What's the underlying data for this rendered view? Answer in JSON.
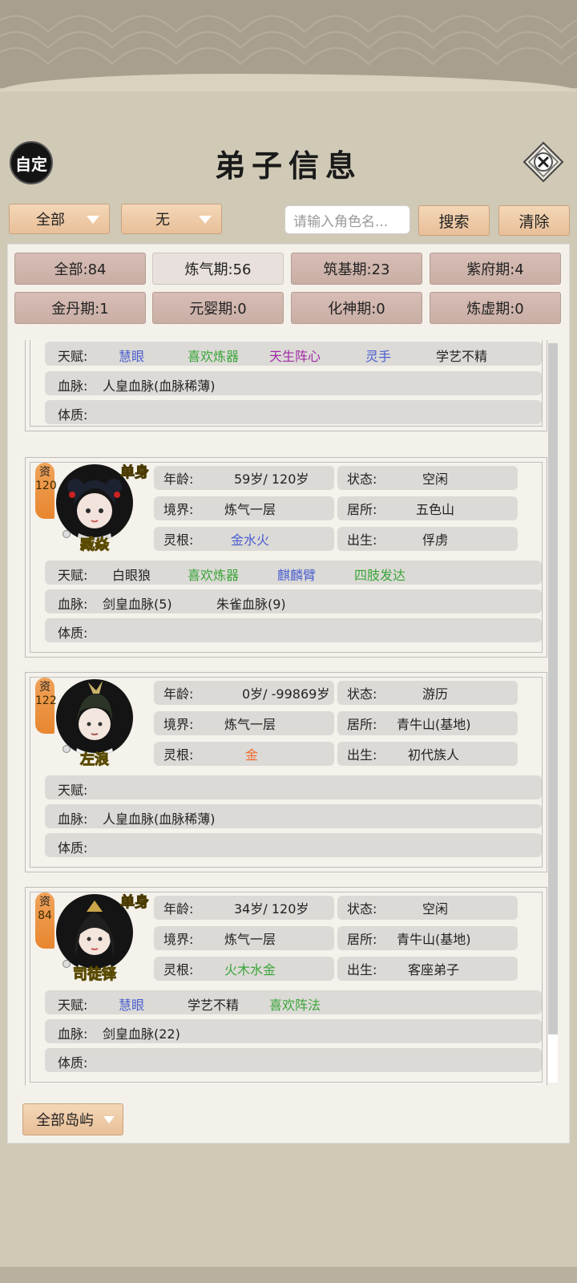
{
  "header": {
    "title": "弟子信息",
    "custom_label": "自定"
  },
  "filters_top": {
    "category": "全部",
    "secondary": "无",
    "search_placeholder": "请输入角色名...",
    "search_label": "搜索",
    "clear_label": "清除"
  },
  "realm_filters": [
    {
      "label": "全部:84",
      "active": false
    },
    {
      "label": "炼气期:56",
      "active": true
    },
    {
      "label": "筑基期:23",
      "active": false
    },
    {
      "label": "紫府期:4",
      "active": false
    },
    {
      "label": "金丹期:1",
      "active": false
    },
    {
      "label": "元婴期:0",
      "active": false
    },
    {
      "label": "化神期:0",
      "active": false
    },
    {
      "label": "炼虚期:0",
      "active": false
    }
  ],
  "labels": {
    "age": "年龄:",
    "status": "状态:",
    "realm": "境界:",
    "residence": "居所:",
    "root": "灵根:",
    "birth": "出生:",
    "talent": "天赋:",
    "bloodline": "血脉:",
    "constitution": "体质:",
    "aptitude": "资",
    "single": "单身"
  },
  "partial_card": {
    "talents": [
      {
        "text": "慧眼",
        "color": "#4a5fd0"
      },
      {
        "text": "喜欢炼器",
        "color": "#3aa53a"
      },
      {
        "text": "天生阵心",
        "color": "#a02aa8"
      },
      {
        "text": "灵手",
        "color": "#4a5fd0"
      },
      {
        "text": "学艺不精",
        "color": "#222222"
      }
    ],
    "bloodlines": [
      "人皇血脉(血脉稀薄)"
    ],
    "constitution": ""
  },
  "disciples": [
    {
      "name": "臧焱",
      "aptitude": "120",
      "single": true,
      "age": "59岁/ 120岁",
      "status": "空闲",
      "realm": "炼气一层",
      "residence": "五色山",
      "root": "金水火",
      "root_color": "#4a5fd0",
      "birth": "俘虏",
      "talents": [
        {
          "text": "白眼狼",
          "color": "#222222"
        },
        {
          "text": "喜欢炼器",
          "color": "#3aa53a"
        },
        {
          "text": "麒麟臂",
          "color": "#4a5fd0"
        },
        {
          "text": "四肢发达",
          "color": "#3aa53a"
        }
      ],
      "bloodlines": [
        "剑皇血脉(5)",
        "朱雀血脉(9)"
      ],
      "constitution": ""
    },
    {
      "name": "左浪",
      "aptitude": "122",
      "single": false,
      "age": "0岁/ -99869岁",
      "status": "游历",
      "realm": "炼气一层",
      "residence": "青牛山(基地)",
      "root": "金",
      "root_color": "#ee6a2e",
      "birth": "初代族人",
      "talents": [],
      "bloodlines": [
        "人皇血脉(血脉稀薄)"
      ],
      "constitution": ""
    },
    {
      "name": "司徒铎",
      "aptitude": "84",
      "single": true,
      "age": "34岁/ 120岁",
      "status": "空闲",
      "realm": "炼气一层",
      "residence": "青牛山(基地)",
      "root": "火木水金",
      "root_color": "#3aa53a",
      "birth": "客座弟子",
      "talents": [
        {
          "text": "慧眼",
          "color": "#4a5fd0"
        },
        {
          "text": "学艺不精",
          "color": "#222222"
        },
        {
          "text": "喜欢阵法",
          "color": "#3aa53a"
        }
      ],
      "bloodlines": [
        "剑皇血脉(22)"
      ],
      "constitution": ""
    }
  ],
  "footer": {
    "island_label": "全部岛屿"
  }
}
